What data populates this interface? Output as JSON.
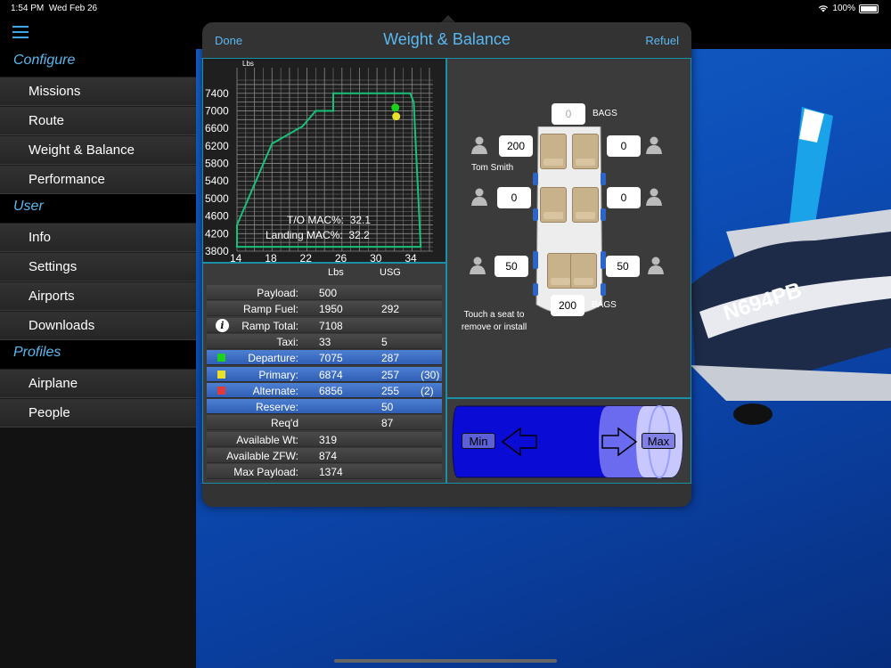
{
  "status": {
    "time": "1:54 PM",
    "date": "Wed Feb 26",
    "battery": "100%"
  },
  "sidebar": {
    "sections": [
      {
        "header": "Configure",
        "items": [
          "Missions",
          "Route",
          "Weight & Balance",
          "Performance"
        ]
      },
      {
        "header": "User",
        "items": [
          "Info",
          "Settings",
          "Airports",
          "Downloads"
        ]
      },
      {
        "header": "Profiles",
        "items": [
          "Airplane",
          "People"
        ]
      }
    ]
  },
  "modal": {
    "done": "Done",
    "title": "Weight & Balance",
    "refuel": "Refuel"
  },
  "chart_data": {
    "type": "scatter",
    "ylabel": "Lbs",
    "x_ticks": [
      "14",
      "18",
      "22",
      "26",
      "30",
      "34"
    ],
    "y_ticks": [
      "7400",
      "7000",
      "6600",
      "6200",
      "5800",
      "5400",
      "5000",
      "4600",
      "4200",
      "3800"
    ],
    "xlim": [
      14,
      36
    ],
    "ylim": [
      3800,
      7700
    ],
    "envelope": [
      [
        14,
        4400
      ],
      [
        18,
        6250
      ],
      [
        21.5,
        6650
      ],
      [
        23,
        7000
      ],
      [
        25,
        7000
      ],
      [
        25,
        7400
      ],
      [
        33.8,
        7400
      ],
      [
        34.2,
        7200
      ],
      [
        35,
        3900
      ],
      [
        14,
        3900
      ]
    ],
    "points": [
      {
        "x": 32.1,
        "y": 7075,
        "color": "#1fd11f"
      },
      {
        "x": 32.2,
        "y": 6874,
        "color": "#e8e02a"
      }
    ],
    "to_mac_label": "T/O  MAC%:",
    "to_mac": "32.1",
    "landing_mac_label": "Landing  MAC%:",
    "landing_mac": "32.2",
    "envelope_color": "#19c07a"
  },
  "table": {
    "col_lbs": "Lbs",
    "col_usg": "USG",
    "rows": [
      {
        "label": "Payload:",
        "lbs": "500",
        "usg": "",
        "par": ""
      },
      {
        "label": "Ramp Fuel:",
        "lbs": "1950",
        "usg": "292",
        "par": ""
      },
      {
        "label": "Ramp Total:",
        "lbs": "7108",
        "usg": "",
        "par": ""
      },
      {
        "label": "Taxi:",
        "lbs": "33",
        "usg": "5",
        "par": ""
      },
      {
        "label": "Departure:",
        "lbs": "7075",
        "usg": "287",
        "par": ""
      },
      {
        "label": "Primary:",
        "lbs": "6874",
        "usg": "257",
        "par": "(30)"
      },
      {
        "label": "Alternate:",
        "lbs": "6856",
        "usg": "255",
        "par": "(2)"
      },
      {
        "label": "Reserve:",
        "lbs": "",
        "usg": "50",
        "par": ""
      },
      {
        "label": "Req'd",
        "lbs": "",
        "usg": "87",
        "par": ""
      },
      {
        "label": "Available Wt:",
        "lbs": "319",
        "usg": "",
        "par": ""
      },
      {
        "label": "Available ZFW:",
        "lbs": "874",
        "usg": "",
        "par": ""
      },
      {
        "label": "Max Payload:",
        "lbs": "1374",
        "usg": "",
        "par": ""
      }
    ],
    "colors": {
      "departure": "#1fd11f",
      "primary": "#e8e02a",
      "alternate": "#e03a3a"
    }
  },
  "seats": {
    "bags_front": "0",
    "bags_label": "BAGS",
    "bags_aft": "200",
    "row1_left": "200",
    "row1_right": "0",
    "row2_left": "0",
    "row2_right": "0",
    "row3_left": "50",
    "row3_right": "50",
    "pilot_name": "Tom Smith",
    "hint": "Touch a seat to remove or install"
  },
  "fuel": {
    "min": "Min",
    "max": "Max"
  },
  "aircraft_reg": "N694PB"
}
